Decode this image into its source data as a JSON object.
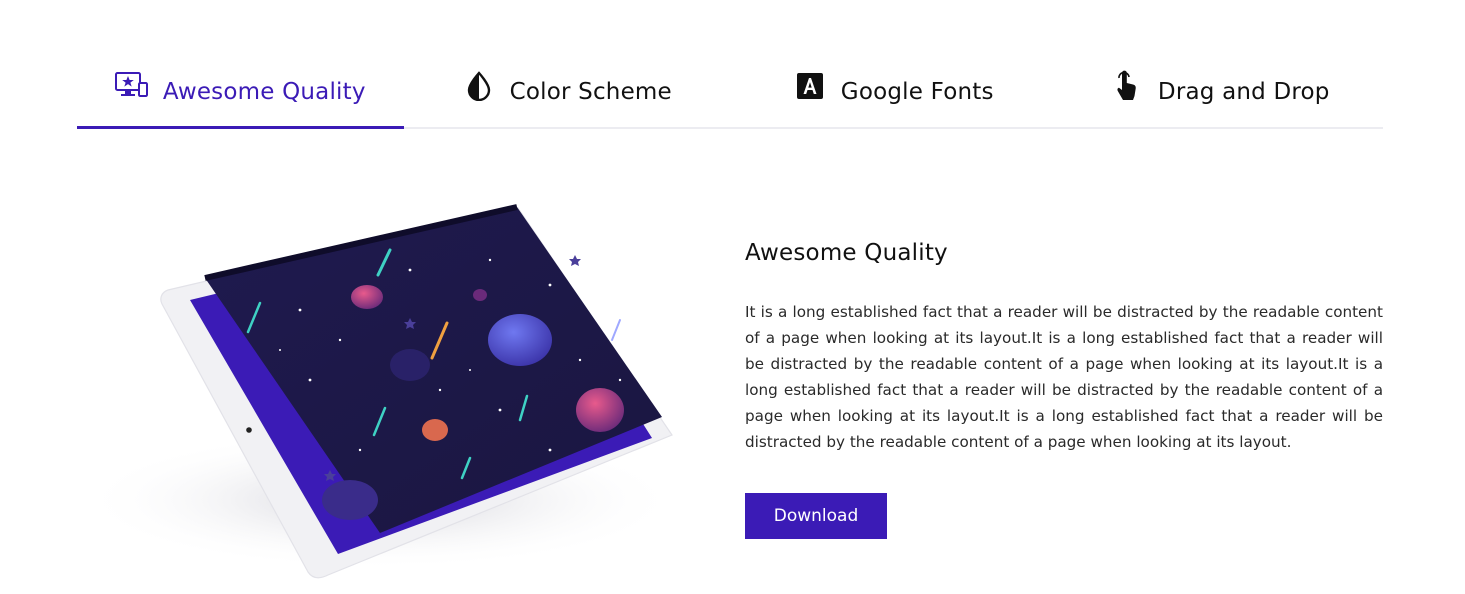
{
  "tabs": [
    {
      "label": "Awesome Quality",
      "icon": "devices-star-icon",
      "active": true
    },
    {
      "label": "Color Scheme",
      "icon": "contrast-icon",
      "active": false
    },
    {
      "label": "Google Fonts",
      "icon": "font-a-icon",
      "active": false
    },
    {
      "label": "Drag and Drop",
      "icon": "pointer-hand-icon",
      "active": false
    }
  ],
  "content": {
    "title": "Awesome Quality",
    "body": "It is a long established fact that a reader will be distracted by the readable content of a page when looking at its layout.It is a long established fact that a reader will be distracted by the readable content of a page when looking at its layout.It is a long established fact that a reader will be distracted by the readable content of a page when looking at its layout.It is a long established fact that a reader will be distracted by the readable content of a page when looking at its layout.",
    "download_label": "Download"
  },
  "colors": {
    "accent": "#3b1bb6",
    "text": "#111111",
    "divider": "#ececf1"
  }
}
